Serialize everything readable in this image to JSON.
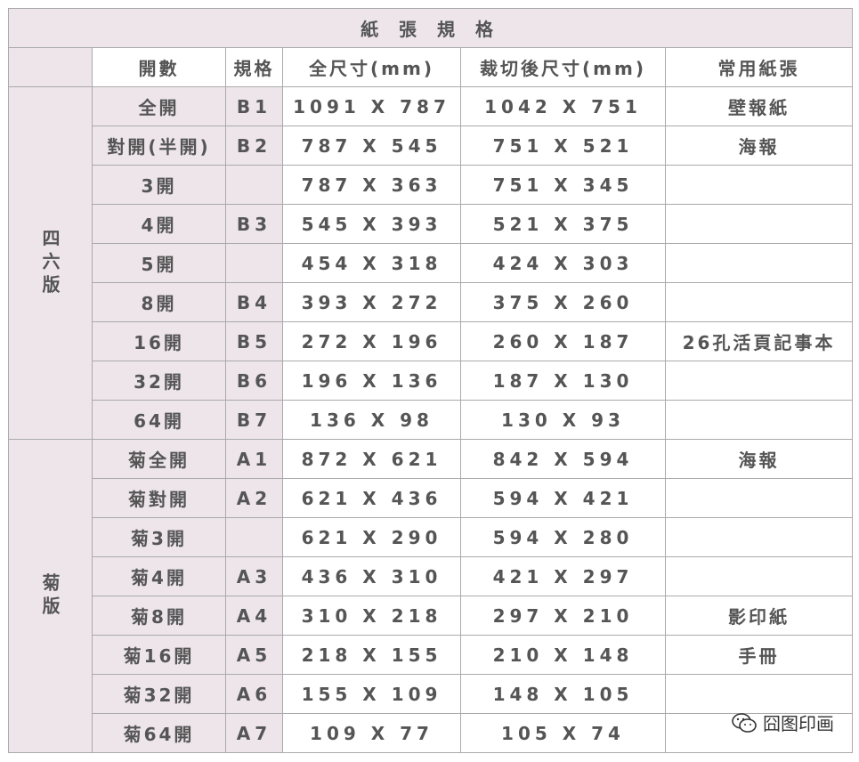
{
  "title": "紙 張 規 格",
  "headers": [
    "",
    "開數",
    "規格",
    "全尺寸(mm)",
    "裁切後尺寸(mm)",
    "常用紙張"
  ],
  "groups": [
    {
      "label": "四六版",
      "rows": [
        {
          "kai": "全開",
          "spec": "B1",
          "full": "1091 X 787",
          "cut": "1042 X 751",
          "common": "壁報紙"
        },
        {
          "kai": "對開(半開)",
          "spec": "B2",
          "full": "787 X 545",
          "cut": "751 X 521",
          "common": "海報"
        },
        {
          "kai": "3開",
          "spec": "",
          "full": "787 X 363",
          "cut": "751 X 345",
          "common": ""
        },
        {
          "kai": "4開",
          "spec": "B3",
          "full": "545 X 393",
          "cut": "521 X 375",
          "common": ""
        },
        {
          "kai": "5開",
          "spec": "",
          "full": "454 X 318",
          "cut": "424 X 303",
          "common": ""
        },
        {
          "kai": "8開",
          "spec": "B4",
          "full": "393 X 272",
          "cut": "375 X 260",
          "common": ""
        },
        {
          "kai": "16開",
          "spec": "B5",
          "full": "272 X 196",
          "cut": "260 X 187",
          "common": "26孔活頁記事本"
        },
        {
          "kai": "32開",
          "spec": "B6",
          "full": "196 X 136",
          "cut": "187 X 130",
          "common": ""
        },
        {
          "kai": "64開",
          "spec": "B7",
          "full": "136 X 98",
          "cut": "130 X 93",
          "common": ""
        }
      ]
    },
    {
      "label": "菊版",
      "rows": [
        {
          "kai": "菊全開",
          "spec": "A1",
          "full": "872 X 621",
          "cut": "842 X 594",
          "common": "海報"
        },
        {
          "kai": "菊對開",
          "spec": "A2",
          "full": "621 X 436",
          "cut": "594 X 421",
          "common": ""
        },
        {
          "kai": "菊3開",
          "spec": "",
          "full": "621 X 290",
          "cut": "594 X 280",
          "common": ""
        },
        {
          "kai": "菊4開",
          "spec": "A3",
          "full": "436 X 310",
          "cut": "421 X 297",
          "common": ""
        },
        {
          "kai": "菊8開",
          "spec": "A4",
          "full": "310 X 218",
          "cut": "297 X 210",
          "common": "影印紙"
        },
        {
          "kai": "菊16開",
          "spec": "A5",
          "full": "218 X 155",
          "cut": "210 X 148",
          "common": "手冊"
        },
        {
          "kai": "菊32開",
          "spec": "A6",
          "full": "155 X 109",
          "cut": "148 X 105",
          "common": ""
        },
        {
          "kai": "菊64開",
          "spec": "A7",
          "full": "109 X 77",
          "cut": "105 X 74",
          "common": ""
        }
      ]
    }
  ],
  "watermark": {
    "icon": "wechat-icon",
    "text": "囧图印画"
  },
  "colors": {
    "tint": "#ede5ea",
    "border": "#aaaaaa",
    "text": "#555555"
  }
}
